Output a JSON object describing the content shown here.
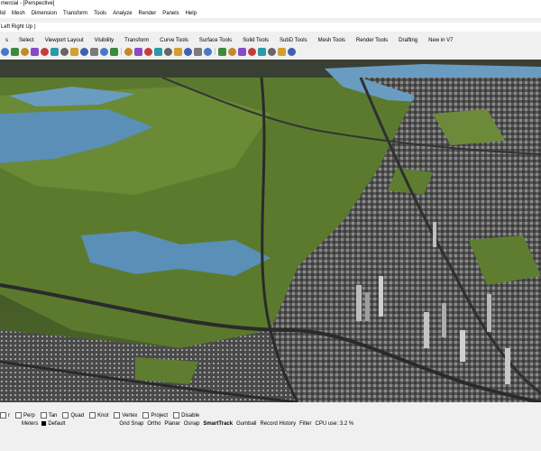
{
  "window": {
    "title": "mercial - [Perspective]"
  },
  "menu": [
    "lid",
    "Mesh",
    "Dimension",
    "Transform",
    "Tools",
    "Analyze",
    "Render",
    "Panels",
    "Help"
  ],
  "command_line": "Left  Right  Up )",
  "toolbar_tabs": [
    "s",
    "Select",
    "Viewport Layout",
    "Visibility",
    "Transform",
    "Curve Tools",
    "Surface Tools",
    "Solid Tools",
    "SubD Tools",
    "Mesh Tools",
    "Render Tools",
    "Drafting",
    "New in V7"
  ],
  "toolbar_icons": [
    "hand-icon",
    "pan-icon",
    "rotate-icon",
    "zoom-icon",
    "zoom-window-icon",
    "zoom-extents-icon",
    "zoom-selected-icon",
    "undo-view-icon",
    "four-view-icon",
    "grid-icon",
    "camera-icon",
    "capture-icon",
    "select-icon",
    "lock-icon",
    "unlock-icon",
    "layer-icon",
    "properties-icon",
    "render-icon",
    "material-icon",
    "light-icon",
    "wireframe-icon",
    "shaded-icon",
    "rendered-icon",
    "ghosted-icon",
    "xray-icon",
    "technical-icon",
    "artistic-icon",
    "pen-icon",
    "help-icon"
  ],
  "osnap": [
    {
      "label": "r"
    },
    {
      "label": "Perp"
    },
    {
      "label": "Tan"
    },
    {
      "label": "Quad"
    },
    {
      "label": "Knot"
    },
    {
      "label": "Vertex"
    },
    {
      "label": "Project"
    },
    {
      "label": "Disable"
    }
  ],
  "status": {
    "units": "Meters",
    "layer": "Default",
    "items": [
      "Grid Snap",
      "Ortho",
      "Planar",
      "Osnap",
      "SmartTrack",
      "Gumball",
      "Record History",
      "Filter",
      "CPU use: 3.2 %"
    ],
    "active_item": "SmartTrack"
  },
  "colors": {
    "terrain_green": "#5b7a2e",
    "water_blue": "#5a8fb8",
    "city_gray": "#6e6e6e"
  }
}
